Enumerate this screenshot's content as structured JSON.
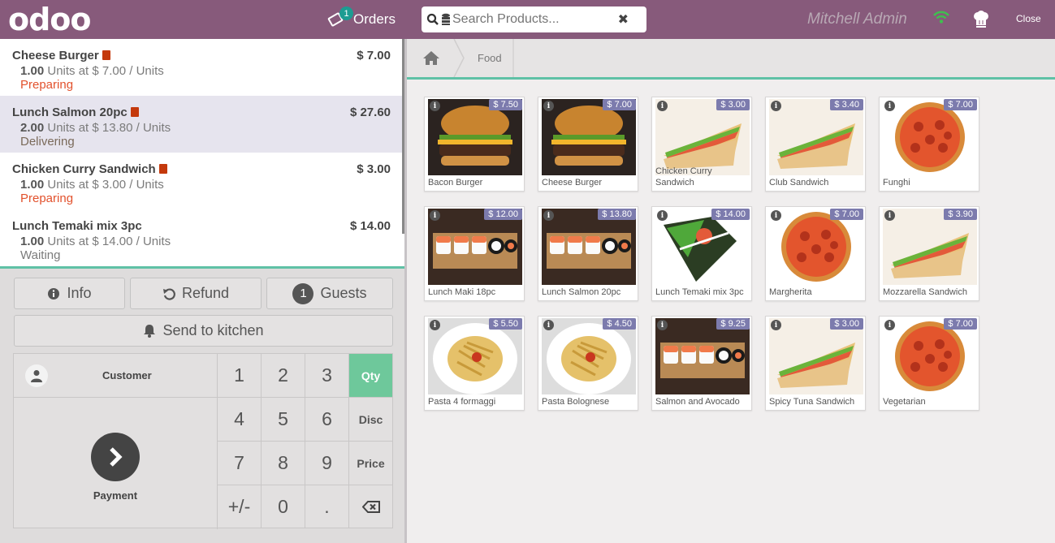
{
  "header": {
    "logo": "odoo",
    "orders_label": "Orders",
    "orders_count": "1",
    "search_placeholder": "Search Products...",
    "user": "Mitchell Admin",
    "close_label": "Close"
  },
  "order_lines": [
    {
      "name": "Cheese Burger",
      "price": "$ 7.00",
      "qty": "1.00",
      "unit_text": "Units at $ 7.00 / Units",
      "status": "Preparing",
      "status_color": "#e2512c"
    },
    {
      "name": "Lunch Salmon 20pc",
      "price": "$ 27.60",
      "qty": "2.00",
      "unit_text": "Units at $ 13.80 / Units",
      "status": "Delivering",
      "status_color": "#7a6a5a"
    },
    {
      "name": "Chicken Curry Sandwich",
      "price": "$ 3.00",
      "qty": "1.00",
      "unit_text": "Units at $ 3.00 / Units",
      "status": "Preparing",
      "status_color": "#e2512c"
    },
    {
      "name": "Lunch Temaki mix 3pc",
      "price": "$ 14.00",
      "qty": "1.00",
      "unit_text": "Units at $ 14.00 / Units",
      "status": "Waiting",
      "status_color": "#7b7b7b"
    }
  ],
  "actions": {
    "info": "Info",
    "refund": "Refund",
    "guests_count": "1",
    "guests": "Guests",
    "send_kitchen": "Send to kitchen"
  },
  "numpad": {
    "customer": "Customer",
    "payment": "Payment",
    "keys": [
      "1",
      "2",
      "3",
      "4",
      "5",
      "6",
      "7",
      "8",
      "9",
      "+/-",
      "0",
      "."
    ],
    "modes": [
      "Qty",
      "Disc",
      "Price"
    ]
  },
  "breadcrumb": {
    "category": "Food"
  },
  "products": [
    {
      "name": "Bacon Burger",
      "price": "$ 7.50",
      "icon": "burger"
    },
    {
      "name": "Cheese Burger",
      "price": "$ 7.00",
      "icon": "burger"
    },
    {
      "name": "Chicken Curry Sandwich",
      "price": "$ 3.00",
      "icon": "sandwich"
    },
    {
      "name": "Club Sandwich",
      "price": "$ 3.40",
      "icon": "sandwich"
    },
    {
      "name": "Funghi",
      "price": "$ 7.00",
      "icon": "pizza"
    },
    {
      "name": "Lunch Maki 18pc",
      "price": "$ 12.00",
      "icon": "sushi"
    },
    {
      "name": "Lunch Salmon 20pc",
      "price": "$ 13.80",
      "icon": "sushi"
    },
    {
      "name": "Lunch Temaki mix 3pc",
      "price": "$ 14.00",
      "icon": "temaki"
    },
    {
      "name": "Margherita",
      "price": "$ 7.00",
      "icon": "pizza"
    },
    {
      "name": "Mozzarella Sandwich",
      "price": "$ 3.90",
      "icon": "sandwich"
    },
    {
      "name": "Pasta 4 formaggi",
      "price": "$ 5.50",
      "icon": "pasta"
    },
    {
      "name": "Pasta Bolognese",
      "price": "$ 4.50",
      "icon": "pasta"
    },
    {
      "name": "Salmon and Avocado",
      "price": "$ 9.25",
      "icon": "sushi"
    },
    {
      "name": "Spicy Tuna Sandwich",
      "price": "$ 3.00",
      "icon": "sandwich"
    },
    {
      "name": "Vegetarian",
      "price": "$ 7.00",
      "icon": "pizza"
    }
  ],
  "colors": {
    "brand": "#875a7b",
    "accent": "#5fc1a6",
    "qty_active": "#6ec89b",
    "price_badge": "#7c7bad"
  }
}
